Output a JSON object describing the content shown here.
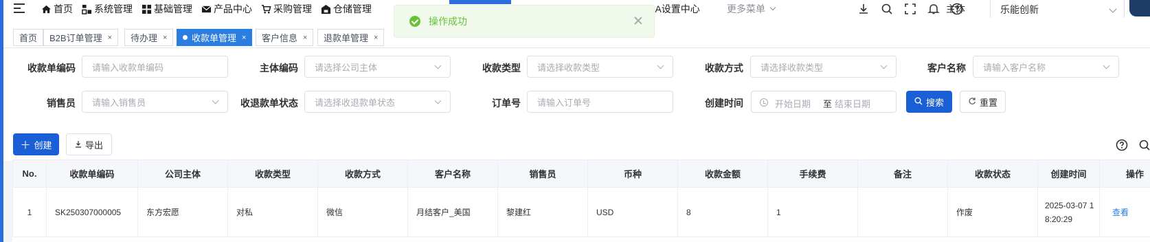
{
  "nav": {
    "items": [
      "首页",
      "系统管理",
      "基础管理",
      "产品中心",
      "采购管理",
      "仓储管理"
    ],
    "pda": "PDA设置中心",
    "more": "更多菜单",
    "subject_label": "主体",
    "subject_value": "乐能创新"
  },
  "toast": {
    "message": "操作成功"
  },
  "tabs": [
    {
      "label": "首页",
      "closable": false,
      "active": false
    },
    {
      "label": "B2B订单管理",
      "closable": true,
      "active": false
    },
    {
      "label": "待办理",
      "closable": true,
      "active": false
    },
    {
      "label": "收款单管理",
      "closable": true,
      "active": true
    },
    {
      "label": "客户信息",
      "closable": true,
      "active": false
    },
    {
      "label": "退款单管理",
      "closable": true,
      "active": false
    }
  ],
  "filters": {
    "receipt_no": {
      "label": "收款单编码",
      "placeholder": "请输入收款单编码"
    },
    "entity_code": {
      "label": "主体编码",
      "placeholder": "请选择公司主体"
    },
    "receipt_type": {
      "label": "收款类型",
      "placeholder": "请选择收款类型"
    },
    "receipt_method": {
      "label": "收款方式",
      "placeholder": "请选择收款类型"
    },
    "customer_name": {
      "label": "客户名称",
      "placeholder": "请输入客户名称"
    },
    "salesperson": {
      "label": "销售员",
      "placeholder": "请输入销售员"
    },
    "refund_status": {
      "label": "收退款单状态",
      "placeholder": "请选择收退款单状态"
    },
    "order_no": {
      "label": "订单号",
      "placeholder": "请输入订单号"
    },
    "created_time": {
      "label": "创建时间",
      "start": "开始日期",
      "separator": "至",
      "end": "结束日期"
    },
    "search_label": "搜索",
    "reset_label": "重置"
  },
  "toolbar": {
    "create_label": "创建",
    "export_label": "导出"
  },
  "table": {
    "headers": [
      "No.",
      "收款单编码",
      "公司主体",
      "收款类型",
      "收款方式",
      "客户名称",
      "销售员",
      "币种",
      "收款金额",
      "手续费",
      "备注",
      "收款状态",
      "创建时间",
      "操作"
    ],
    "rows": [
      {
        "no": "1",
        "receipt_no": "SK250307000005",
        "entity": "东方宏愿",
        "type": "对私",
        "method": "微信",
        "customer": "月结客户_美国",
        "salesperson": "黎建红",
        "currency": "USD",
        "amount": "8",
        "fee": "1",
        "remark": "",
        "status": "作废",
        "created": "2025-03-07 18:20:29",
        "action": "查看"
      }
    ]
  },
  "colors": {
    "primary": "#1a5fd6",
    "tab_active": "#2a7de1",
    "success": "#67c23a"
  }
}
